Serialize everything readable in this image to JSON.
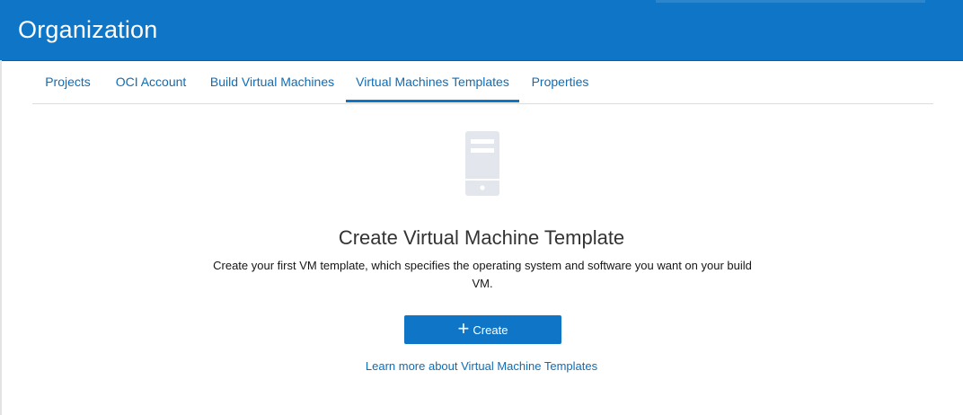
{
  "header": {
    "title": "Organization"
  },
  "tabs": [
    {
      "label": "Projects",
      "active": false
    },
    {
      "label": "OCI Account",
      "active": false
    },
    {
      "label": "Build Virtual Machines",
      "active": false
    },
    {
      "label": "Virtual Machines Templates",
      "active": true
    },
    {
      "label": "Properties",
      "active": false
    }
  ],
  "empty_state": {
    "icon": "server-icon",
    "heading": "Create Virtual Machine Template",
    "description": "Create your first VM template, which specifies the operating system and software you want on your build VM.",
    "create_button": {
      "icon": "plus-icon",
      "label": "Create"
    },
    "learn_more_link": "Learn more about Virtual Machine Templates"
  },
  "colors": {
    "header_bg": "#0f76c7",
    "link": "#0f6cb5",
    "button_bg": "#0f76c7",
    "icon_gray": "#e3e7ed"
  }
}
